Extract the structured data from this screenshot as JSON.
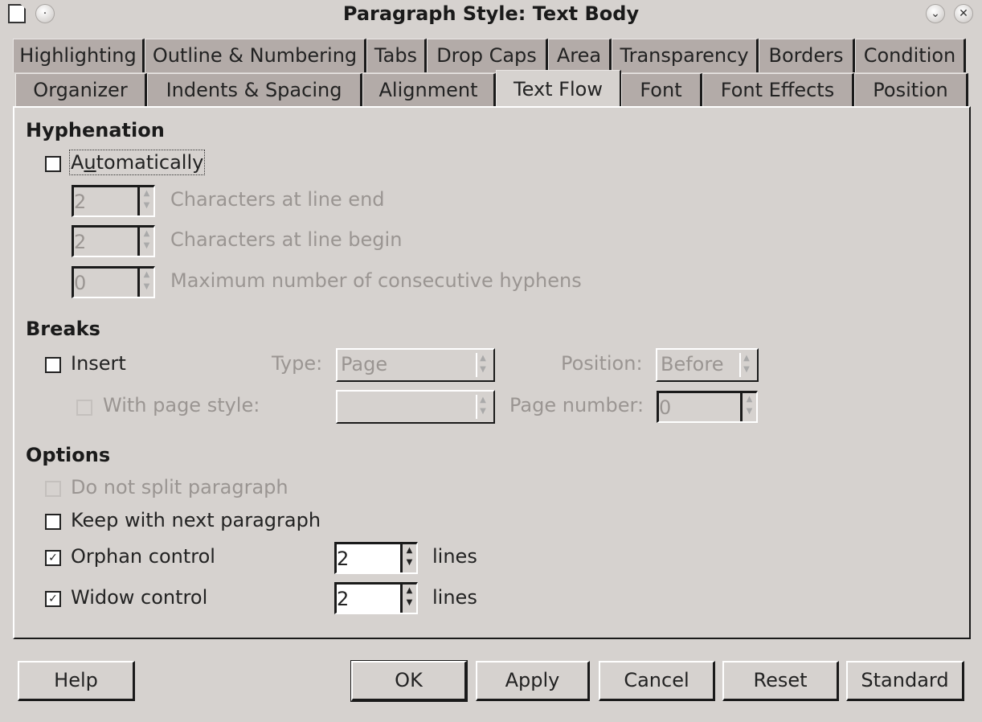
{
  "window": {
    "title": "Paragraph Style: Text Body"
  },
  "tabs_row1": [
    "Highlighting",
    "Outline & Numbering",
    "Tabs",
    "Drop Caps",
    "Area",
    "Transparency",
    "Borders",
    "Condition"
  ],
  "tabs_row2": [
    "Organizer",
    "Indents & Spacing",
    "Alignment",
    "Text Flow",
    "Font",
    "Font Effects",
    "Position"
  ],
  "active_tab": "Text Flow",
  "hyphenation": {
    "heading": "Hyphenation",
    "automatically": {
      "label": "Automatically",
      "checked": false
    },
    "chars_line_end": {
      "value": "2",
      "label": "Characters at line end"
    },
    "chars_line_begin": {
      "value": "2",
      "label": "Characters at line begin"
    },
    "max_hyphens": {
      "value": "0",
      "label": "Maximum number of consecutive hyphens"
    }
  },
  "breaks": {
    "heading": "Breaks",
    "insert": {
      "label": "Insert",
      "checked": false
    },
    "type_label": "Type:",
    "type_value": "Page",
    "position_label": "Position:",
    "position_value": "Before",
    "with_page_style": {
      "label": "With page style:",
      "checked": false
    },
    "page_style_value": "",
    "page_number_label": "Page number:",
    "page_number_value": "0"
  },
  "options": {
    "heading": "Options",
    "do_not_split": {
      "label": "Do not split paragraph",
      "checked": false
    },
    "keep_with_next": {
      "label": "Keep with next paragraph",
      "checked": false
    },
    "orphan": {
      "label": "Orphan control",
      "checked": true,
      "value": "2",
      "unit": "lines"
    },
    "widow": {
      "label": "Widow control",
      "checked": true,
      "value": "2",
      "unit": "lines"
    }
  },
  "buttons": {
    "help": "Help",
    "ok": "OK",
    "apply": "Apply",
    "cancel": "Cancel",
    "reset": "Reset",
    "standard": "Standard"
  },
  "icons": {
    "check": "✓",
    "up": "▲",
    "down": "▼",
    "minimize": "⌄",
    "close": "✕"
  }
}
